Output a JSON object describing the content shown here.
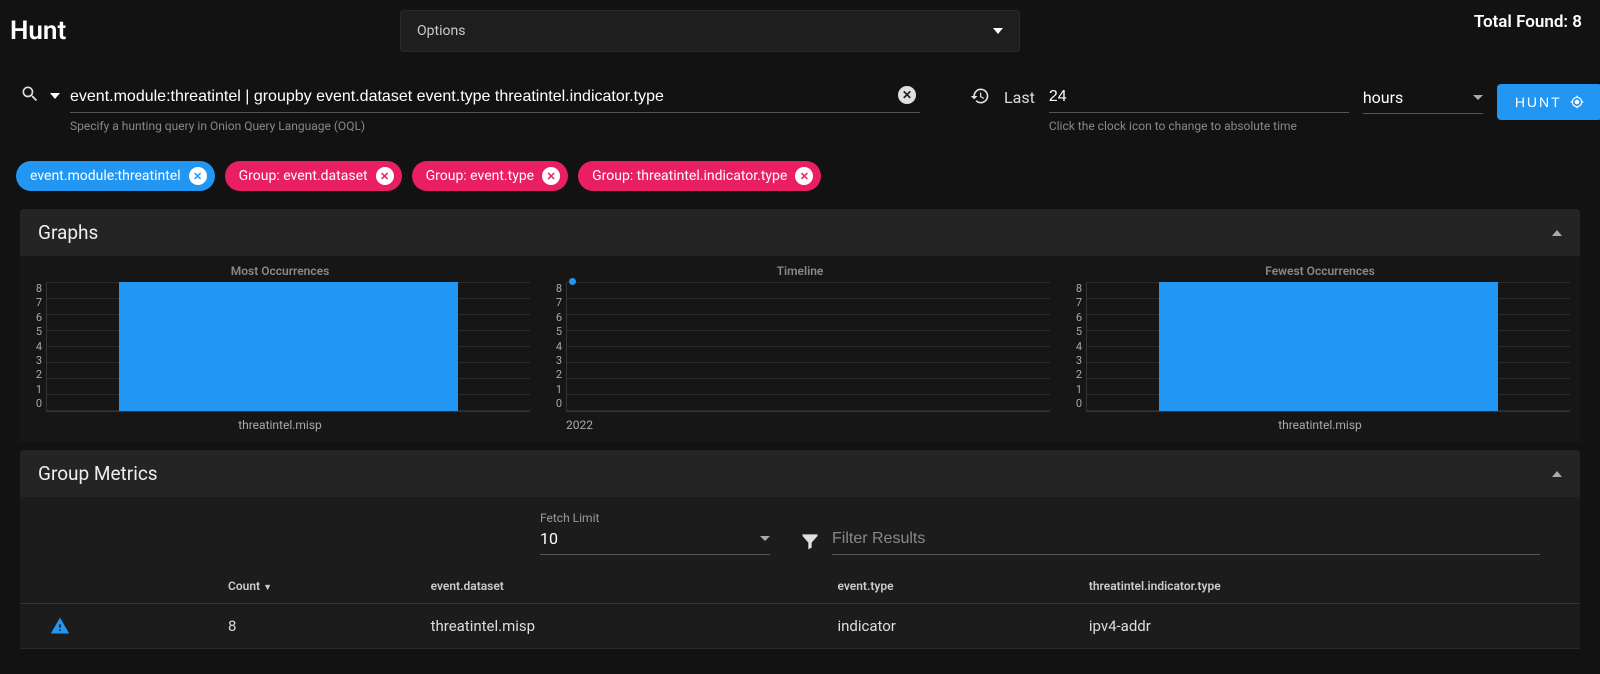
{
  "header": {
    "title": "Hunt",
    "options_label": "Options",
    "total_found_label": "Total Found: 8"
  },
  "query": {
    "value": "event.module:threatintel | groupby event.dataset event.type threatintel.indicator.type",
    "helper": "Specify a hunting query in Onion Query Language (OQL)"
  },
  "time": {
    "mode_label": "Last",
    "value": "24",
    "unit": "hours",
    "helper": "Click the clock icon to change to absolute time"
  },
  "hunt_button": "HUNT",
  "chips": [
    {
      "label": "event.module:threatintel",
      "color": "blue"
    },
    {
      "label": "Group: event.dataset",
      "color": "pink"
    },
    {
      "label": "Group: event.type",
      "color": "pink"
    },
    {
      "label": "Group: threatintel.indicator.type",
      "color": "pink"
    }
  ],
  "panels": {
    "graphs_title": "Graphs",
    "group_metrics_title": "Group Metrics"
  },
  "chart_data": [
    {
      "type": "bar",
      "title": "Most Occurrences",
      "categories": [
        "threatintel.misp"
      ],
      "values": [
        8
      ],
      "ylim": [
        0,
        8
      ],
      "yticks": [
        0,
        1,
        2,
        3,
        4,
        5,
        6,
        7,
        8
      ]
    },
    {
      "type": "scatter",
      "title": "Timeline",
      "x": [
        "2022"
      ],
      "values": [
        8
      ],
      "ylim": [
        0,
        8
      ],
      "yticks": [
        0,
        1,
        2,
        3,
        4,
        5,
        6,
        7,
        8
      ]
    },
    {
      "type": "bar",
      "title": "Fewest Occurrences",
      "categories": [
        "threatintel.misp"
      ],
      "values": [
        8
      ],
      "ylim": [
        0,
        8
      ],
      "yticks": [
        0,
        1,
        2,
        3,
        4,
        5,
        6,
        7,
        8
      ]
    }
  ],
  "metrics": {
    "fetch_label": "Fetch Limit",
    "fetch_value": "10",
    "filter_placeholder": "Filter Results",
    "columns": [
      "Count",
      "event.dataset",
      "event.type",
      "threatintel.indicator.type"
    ],
    "rows": [
      {
        "count": "8",
        "dataset": "threatintel.misp",
        "type": "indicator",
        "indicator_type": "ipv4-addr"
      }
    ]
  }
}
